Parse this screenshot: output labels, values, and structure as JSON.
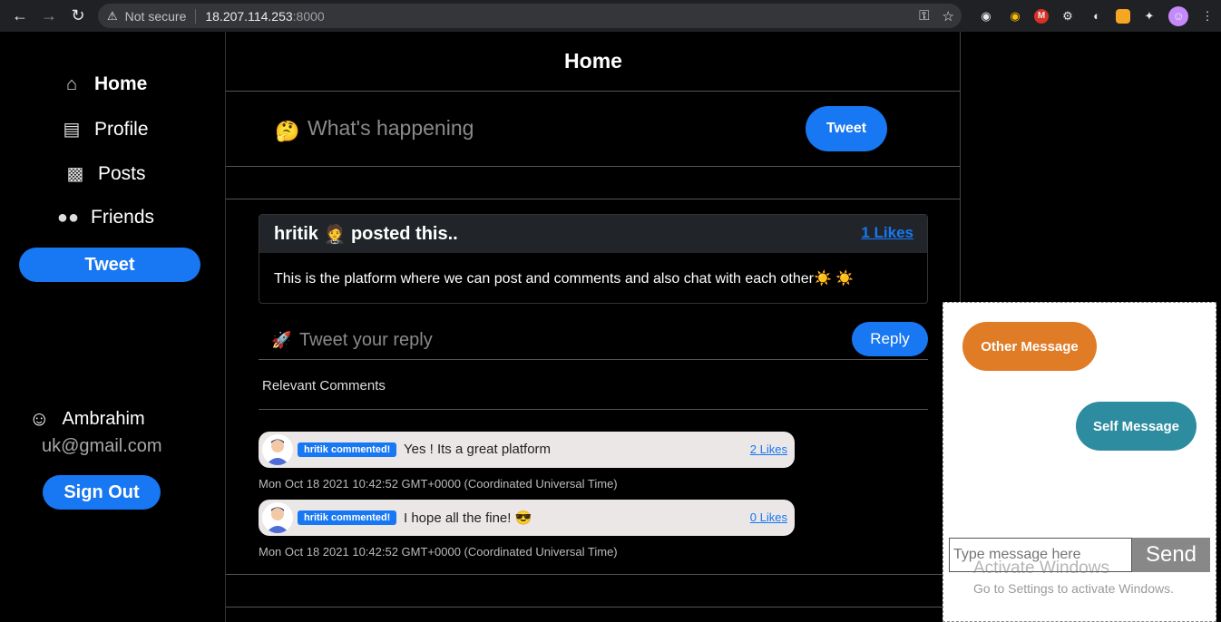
{
  "browser": {
    "not_secure": "Not secure",
    "url_host": "18.207.114.253",
    "url_port": ":8000"
  },
  "sidebar": {
    "items": [
      {
        "label": "Home",
        "icon": "home-icon"
      },
      {
        "label": "Profile",
        "icon": "id-card-icon"
      },
      {
        "label": "Posts",
        "icon": "posts-icon"
      },
      {
        "label": "Friends",
        "icon": "users-icon"
      }
    ],
    "tweet_label": "Tweet",
    "user_name": "Ambrahim",
    "user_email": "uk@gmail.com",
    "signout_label": "Sign Out"
  },
  "main": {
    "title": "Home",
    "compose_emoji": "🤔",
    "compose_placeholder": "What's happening",
    "compose_button": "Tweet",
    "post": {
      "author": "hritik",
      "author_emoji": "🤵",
      "posted_text": "posted this..",
      "likes": "1 Likes",
      "body": "This is the platform where we can post and comments and also chat with each other☀️ ☀️"
    },
    "reply_emoji": "🚀",
    "reply_placeholder": "Tweet your reply",
    "reply_button": "Reply",
    "relevant_title": "Relevant Comments",
    "comments": [
      {
        "badge": "hritik commented!",
        "text": "Yes ! Its a great platform",
        "likes": "2 Likes",
        "time": "Mon Oct 18 2021 10:42:52 GMT+0000 (Coordinated Universal Time)"
      },
      {
        "badge": "hritik commented!",
        "text": "I hope all the fine! 😎",
        "likes": "0 Likes",
        "time": "Mon Oct 18 2021 10:42:52 GMT+0000 (Coordinated Universal Time)"
      }
    ]
  },
  "chat": {
    "other_message": "Other Message",
    "self_message": "Self Message",
    "input_placeholder": "Type message here",
    "send_label": "Send"
  },
  "watermark": {
    "line1": "Activate Windows",
    "line2": "Go to Settings to activate Windows."
  }
}
